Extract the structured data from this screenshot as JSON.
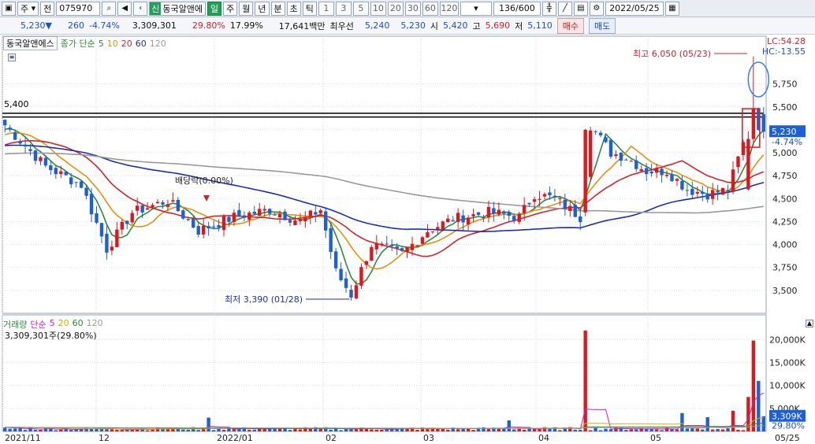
{
  "toolbar": {
    "market_letter": "주",
    "prev_label": "전",
    "code": "075970",
    "name_badge": "신",
    "stock_name": "동국알앤에",
    "periods": [
      "일",
      "주",
      "월",
      "년",
      "분",
      "초",
      "틱"
    ],
    "active_period": "일",
    "intervals": [
      "1",
      "3",
      "5",
      "10",
      "20",
      "30",
      "60",
      "120"
    ],
    "count": "136/600",
    "date": "2022/05/25"
  },
  "quote": {
    "price": "5,230",
    "change": "260",
    "change_pct": "-4.74%",
    "volume": "3,309,301",
    "volume_pct": "29.80%",
    "turnover": "17.99%",
    "amount": "17,641백만",
    "prev_label": "최우선",
    "ask": "5,240",
    "bid": "5,230",
    "open_label": "시",
    "open": "5,420",
    "high_label": "고",
    "high": "5,690",
    "low_label": "저",
    "low": "5,110",
    "buy_label": "매수",
    "sell_label": "매도"
  },
  "price_legend": {
    "name": "동국알앤에스",
    "type": "종가 단순",
    "ma": [
      "5",
      "10",
      "20",
      "60",
      "120"
    ],
    "ma_colors": [
      "#2e8b3a",
      "#e8900c",
      "#d2232a",
      "#1a2fb5",
      "#9a9a9a"
    ]
  },
  "lc": "LC:54.28",
  "hc": "HC:-13.55",
  "volume_legend": {
    "name": "거래량",
    "type": "단순",
    "ma": [
      "5",
      "20",
      "60",
      "120"
    ],
    "ma_colors": [
      "#c71ec7",
      "#d4b000",
      "#2e8b3a",
      "#9a9a9a"
    ],
    "total": "3,309,301주(29.80%)"
  },
  "annotations": {
    "high": "최고 6,050 (05/23)",
    "low": "최저 3,390 (01/28)",
    "dividend": "배당락(0.00%)",
    "level_label": "5,400",
    "current_tag": "5,230",
    "current_pct": "-4.74%",
    "vol_tag": "3,309K",
    "vol_pct_tag": "29.80%"
  },
  "chart_data": {
    "type": "candlestick",
    "price_ticks": [
      "5,750",
      "5,500",
      "5,250",
      "5,000",
      "4,750",
      "4,500",
      "4,250",
      "4,000",
      "3,750",
      "3,500"
    ],
    "price_tick_values": [
      5750,
      5500,
      5250,
      5000,
      4750,
      4500,
      4250,
      4000,
      3750,
      3500
    ],
    "volume_ticks": [
      "20,000K",
      "15,000K",
      "10,000K",
      "5,000K"
    ],
    "volume_tick_values": [
      20000,
      15000,
      10000,
      5000
    ],
    "x_labels": [
      "2021/11",
      "12",
      "2022/01",
      "02",
      "03",
      "04",
      "05",
      "05/25"
    ],
    "close_waypoints": [
      [
        0,
        5300
      ],
      [
        8,
        4850
      ],
      [
        15,
        4650
      ],
      [
        20,
        3950
      ],
      [
        25,
        4350
      ],
      [
        32,
        4480
      ],
      [
        38,
        4150
      ],
      [
        45,
        4300
      ],
      [
        52,
        4380
      ],
      [
        58,
        4250
      ],
      [
        62,
        4380
      ],
      [
        65,
        3700
      ],
      [
        68,
        3450
      ],
      [
        72,
        4000
      ],
      [
        78,
        3900
      ],
      [
        83,
        4150
      ],
      [
        88,
        4280
      ],
      [
        95,
        4350
      ],
      [
        101,
        4300
      ],
      [
        104,
        4550
      ],
      [
        108,
        4500
      ],
      [
        113,
        4300
      ],
      [
        115,
        5300
      ],
      [
        119,
        5000
      ],
      [
        122,
        4950
      ],
      [
        126,
        4800
      ],
      [
        130,
        4800
      ],
      [
        134,
        4600
      ],
      [
        138,
        4550
      ],
      [
        142,
        4600
      ],
      [
        145,
        5100
      ],
      [
        147,
        5400
      ],
      [
        149,
        5230
      ]
    ],
    "volume_spikes": {
      "40": 3000,
      "99": 2400,
      "114": 22000,
      "133": 4000,
      "138": 3100,
      "143": 4500,
      "146": 7500,
      "147": 19800,
      "148": 11000,
      "149": 3309
    }
  }
}
